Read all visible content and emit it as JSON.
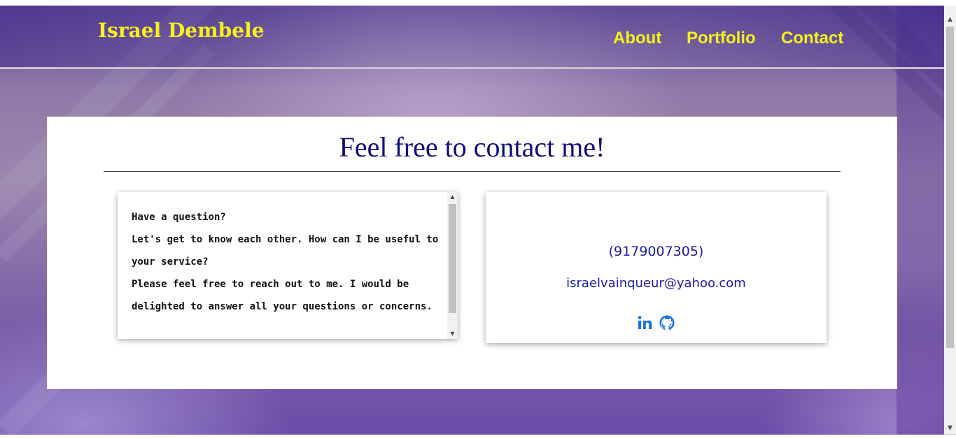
{
  "header": {
    "brand": "Israel Dembele",
    "nav": {
      "about": "About",
      "portfolio": "Portfolio",
      "contact": "Contact"
    }
  },
  "main": {
    "title": "Feel free to contact me!",
    "message": {
      "line1": "Have a question?",
      "line2": "Let's get to know each other. How can I be useful to your service?",
      "line3": "Please feel free to reach out to me. I would be delighted to answer all your questions or concerns."
    },
    "contact": {
      "phone": "(9179007305)",
      "email": "israelvainqueur@yahoo.com",
      "socials": [
        {
          "icon": "linkedin-icon"
        },
        {
          "icon": "github-icon"
        }
      ]
    }
  },
  "colors": {
    "brand": "#f4f21a",
    "title": "#0d0d7a",
    "link": "#1a1aa8",
    "social": "#1a73e8"
  }
}
